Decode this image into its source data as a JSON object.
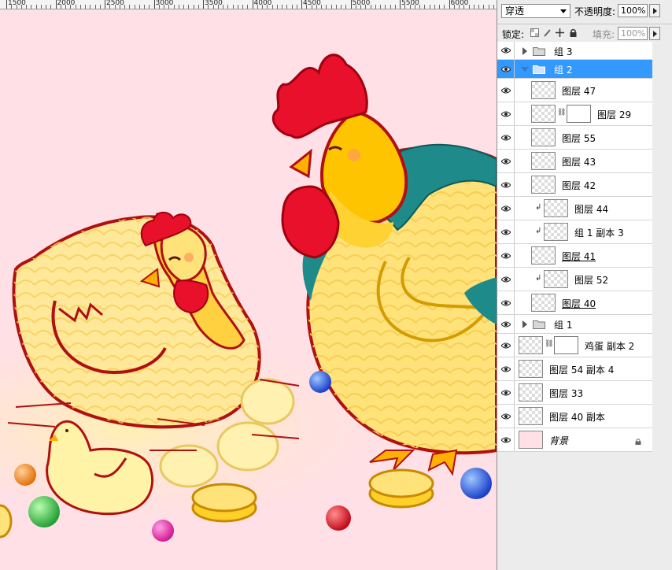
{
  "ruler": {
    "labels": [
      "1500",
      "2000",
      "2500",
      "3000",
      "3500",
      "4000",
      "4500",
      "5000",
      "5500",
      "6000"
    ]
  },
  "layers_panel": {
    "blend_mode": "穿透",
    "opacity_label": "不透明度:",
    "opacity_value": "100%",
    "lock_label": "锁定:",
    "fill_label": "填充:",
    "fill_value": "100%",
    "layers": [
      {
        "name": "组 3",
        "kind": "group",
        "expanded": false
      },
      {
        "name": "组 2",
        "kind": "group",
        "expanded": true,
        "selected": true
      },
      {
        "name": "图层 47",
        "kind": "layer"
      },
      {
        "name": "图层 29",
        "kind": "layer",
        "mask": true
      },
      {
        "name": "图层 55",
        "kind": "layer"
      },
      {
        "name": "图层 43",
        "kind": "layer"
      },
      {
        "name": "图层 42",
        "kind": "layer"
      },
      {
        "name": "图层 44",
        "kind": "layer",
        "clipped": true
      },
      {
        "name": "组 1 副本 3",
        "kind": "layer",
        "clipped": true
      },
      {
        "name": "图层 41",
        "kind": "layer"
      },
      {
        "name": "图层 52",
        "kind": "layer",
        "clipped": true
      },
      {
        "name": "图层 40",
        "kind": "layer"
      },
      {
        "name": "组 1",
        "kind": "group",
        "expanded": false
      },
      {
        "name": "鸡蛋 副本 2",
        "kind": "layer",
        "mask": true
      },
      {
        "name": "图层 54 副本 4",
        "kind": "layer"
      },
      {
        "name": "图层 33",
        "kind": "layer"
      },
      {
        "name": "图层 40 副本",
        "kind": "layer"
      },
      {
        "name": "背景",
        "kind": "background",
        "locked": true
      }
    ]
  },
  "colors": {
    "canvas_bg": "#ffe0e6",
    "selection": "#3399ff",
    "hen_body": "#ffe27a",
    "outline": "#b01010",
    "comb": "#e8102a",
    "teal_feather": "#1f8a8a"
  }
}
